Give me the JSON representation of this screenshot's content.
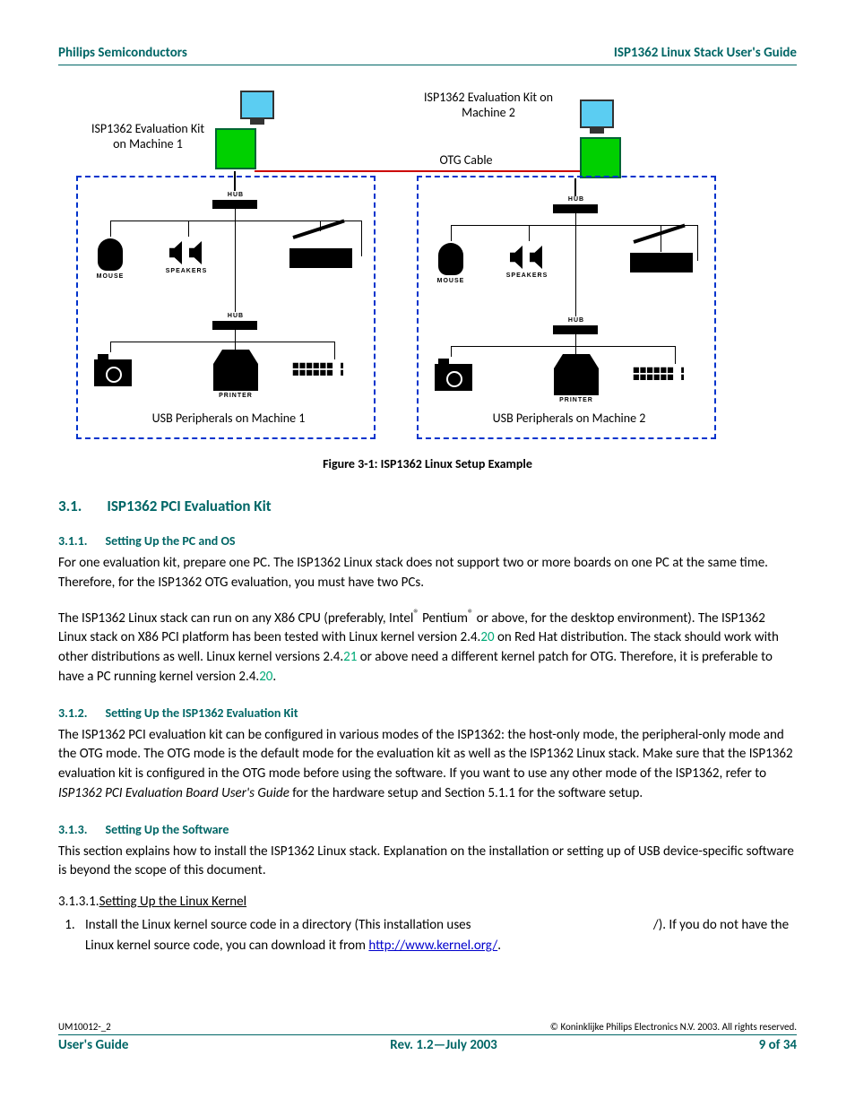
{
  "header": {
    "left": "Philips Semiconductors",
    "right": "ISP1362 Linux Stack User's Guide"
  },
  "figure": {
    "caption": "Figure 3-1: ISP1362 Linux Setup Example",
    "label_kit1": "ISP1362 Evaluation Kit on Machine 1",
    "label_kit2": "ISP1362 Evaluation Kit on Machine 2",
    "label_otg": "OTG Cable",
    "label_usb1": "USB Peripherals on Machine 1",
    "label_usb2": "USB Peripherals on Machine 2",
    "hub": "HUB",
    "mouse": "MOUSE",
    "speakers": "SPEAKERS",
    "printer": "PRINTER"
  },
  "s31": {
    "num": "3.1.",
    "title": "ISP1362 PCI Evaluation Kit"
  },
  "s311": {
    "num": "3.1.1.",
    "title": "Setting Up the PC and OS",
    "p1": "For one evaluation kit, prepare one PC. The ISP1362 Linux stack does not support two or more boards on one PC at the same time. Therefore, for the ISP1362 OTG evaluation, you must have two PCs.",
    "p2a": "The ISP1362 Linux stack can run on any X86 CPU (preferably, Intel",
    "p2reg1": "®",
    "p2b": " Pentium",
    "p2reg2": "®",
    "p2c": " or above, for the desktop environment). The ISP1362 Linux stack on X86 PCI platform has been tested with Linux kernel version 2.4.",
    "p2v1": "20",
    "p2d": " on Red Hat distribution. The stack should work with other distributions as well. Linux kernel versions 2.4.",
    "p2v2": "21",
    "p2e": " or above need a different kernel patch for OTG. Therefore, it is preferable to have a PC running kernel version 2.4.",
    "p2v3": "20",
    "p2f": "."
  },
  "s312": {
    "num": "3.1.2.",
    "title": "Setting Up the ISP1362 Evaluation Kit",
    "p1a": "The ISP1362 PCI evaluation kit can be configured in various modes of the ISP1362: the host-only mode, the peripheral-only mode and the OTG mode. The OTG mode is the default mode for the evaluation kit as well as the ISP1362 Linux stack. Make sure that the ISP1362 evaluation kit is configured in the OTG mode before using the software. If you want to use any other mode of the ISP1362, refer to ",
    "p1ital": "ISP1362 PCI Evaluation Board User's Guide",
    "p1b": " for the hardware setup and Section 5.1.1 for the software setup."
  },
  "s313": {
    "num": "3.1.3.",
    "title": "Setting Up the Software",
    "p1": "This section explains how to install the ISP1362 Linux stack. Explanation on the installation or setting up of USB device-specific software is beyond the scope of this document."
  },
  "s3131": {
    "num": "3.1.3.1.",
    "title": "Setting Up the Linux Kernel",
    "step1a": "Install the Linux kernel source code in a directory (This installation uses ",
    "step1b": "/). If you do not have the Linux kernel source code, you can download it from ",
    "step1link": "http://www.kernel.org/",
    "step1c": "."
  },
  "footer": {
    "docnum": "UM10012-_2",
    "copyright": "© Koninklijke Philips Electronics N.V. 2003. All rights reserved.",
    "left": "User's Guide",
    "center": "Rev. 1.2—July 2003",
    "right": "9 of 34"
  }
}
